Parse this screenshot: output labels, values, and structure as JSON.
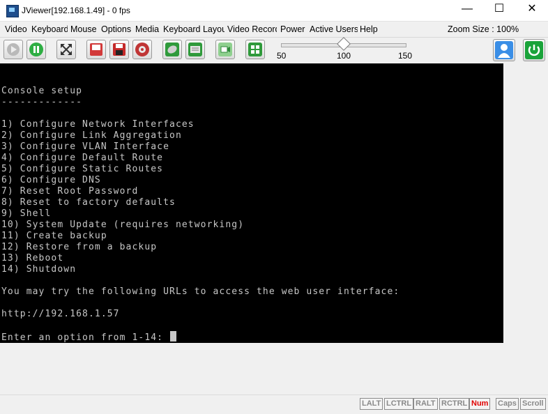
{
  "window": {
    "title": "JViewer[192.168.1.49] - 0 fps",
    "minimize": "—",
    "maximize": "☐",
    "close": "✕"
  },
  "menu": {
    "items": [
      "Video",
      "Keyboard",
      "Mouse",
      "Options",
      "Media",
      "Keyboard Layout",
      "Video Record",
      "Power",
      "Active Users",
      "Help"
    ],
    "zoom_label": "Zoom Size : 100%"
  },
  "toolbar": {
    "buttons": [
      "play-icon",
      "pause-icon",
      "fullscreen-icon",
      "floppy-media-icon",
      "save-icon",
      "cd-media-icon",
      "mouse-icon",
      "keyboard-icon",
      "video-record-icon",
      "hotkeys-icon",
      "user-icon",
      "power-icon"
    ],
    "slider": {
      "min_label": "50",
      "mid_label": "100",
      "max_label": "150",
      "value": 100
    }
  },
  "console": {
    "lines": [
      "",
      "Console setup",
      "-------------",
      "",
      "1) Configure Network Interfaces",
      "2) Configure Link Aggregation",
      "3) Configure VLAN Interface",
      "4) Configure Default Route",
      "5) Configure Static Routes",
      "6) Configure DNS",
      "7) Reset Root Password",
      "8) Reset to factory defaults",
      "9) Shell",
      "10) System Update (requires networking)",
      "11) Create backup",
      "12) Restore from a backup",
      "13) Reboot",
      "14) Shutdown",
      "",
      "You may try the following URLs to access the web user interface:",
      "",
      "http://192.168.1.57",
      ""
    ],
    "prompt": "Enter an option from 1-14: "
  },
  "status": {
    "keys": [
      {
        "label": "LALT",
        "on": false
      },
      {
        "label": "LCTRL",
        "on": false
      },
      {
        "label": "RALT",
        "on": false
      },
      {
        "label": "RCTRL",
        "on": false
      },
      {
        "label": "Num",
        "on": true
      },
      {
        "label": "Caps",
        "on": false
      },
      {
        "label": "Scroll",
        "on": false
      }
    ],
    "active_color": "#e00000"
  },
  "colors": {
    "console_bg": "#000000",
    "console_fg": "#c7c7c7",
    "accent_blue": "#3a8ee6",
    "power_green": "#1aa33a"
  }
}
